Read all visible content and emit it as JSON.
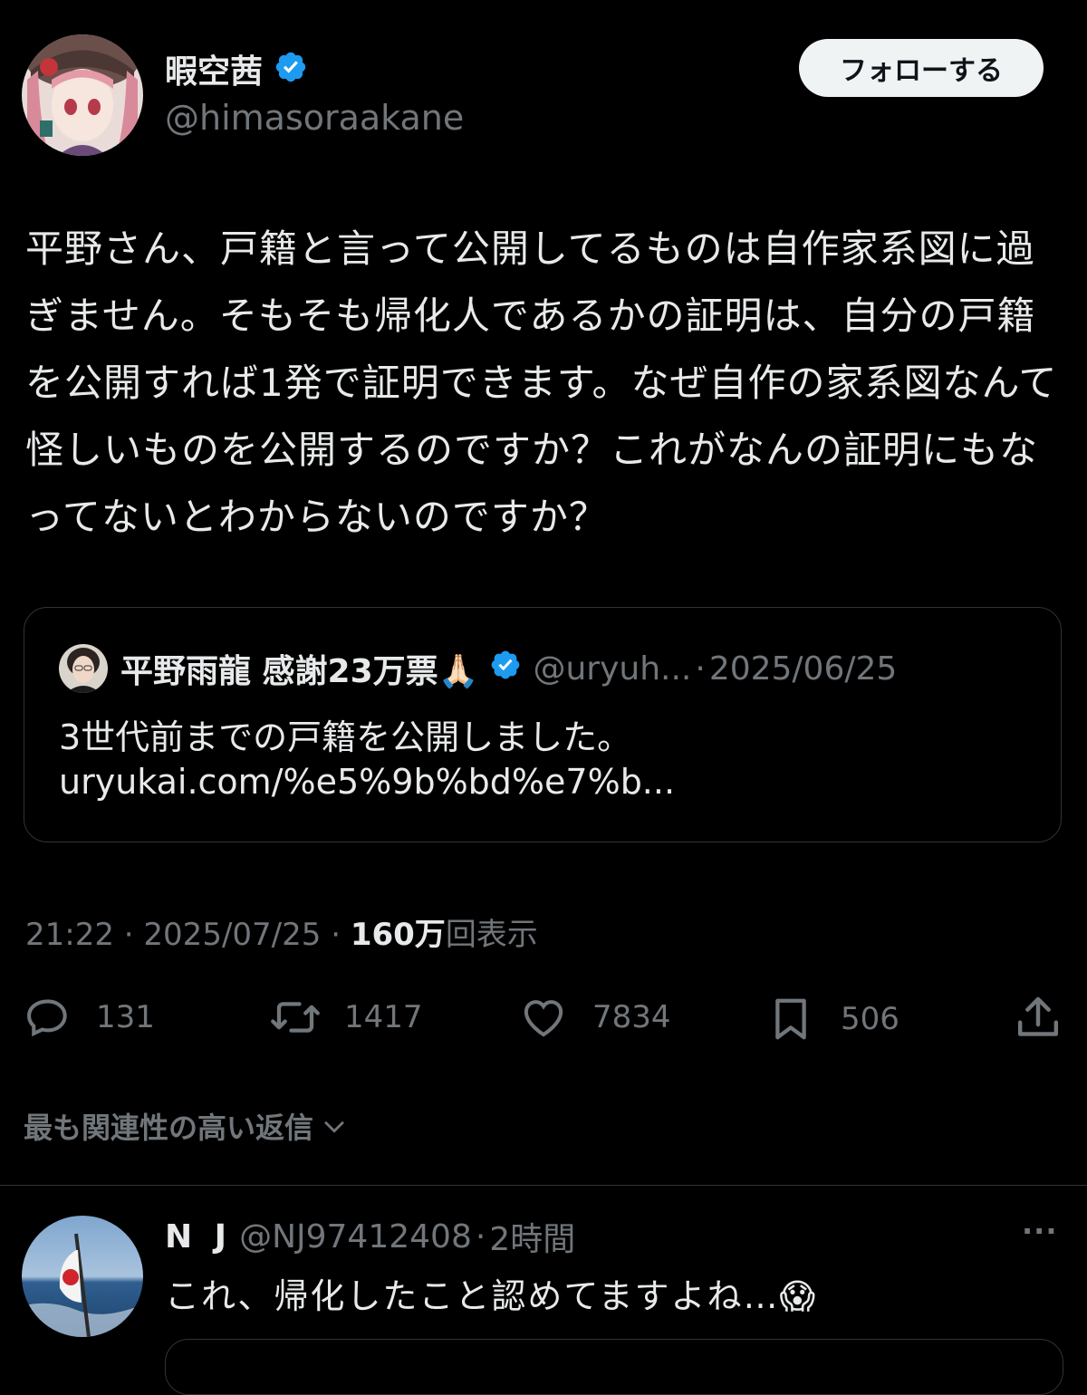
{
  "author": {
    "display_name": "暇空茜",
    "handle": "@himasoraakane",
    "verified": true
  },
  "follow_label": "フォローする",
  "tweet_text": "平野さん、戸籍と言って公開してるものは自作家系図に過ぎません。そもそも帰化人であるかの証明は、自分の戸籍を公開すれば1発で証明できます。なぜ自作の家系図なんて怪しいものを公開するのですか？これがなんの証明にもなってないとわからないのですか？",
  "quote": {
    "display_name": "平野雨龍 感謝23万票🙏🏻",
    "handle": "@uryuh...",
    "separator": "·",
    "date": "2025/06/25",
    "text": "3世代前までの戸籍を公開しました。",
    "link": "uryukai.com/%e5%9b%bd%e7%b..."
  },
  "meta": {
    "time": "21:22",
    "sep1": "·",
    "date": "2025/07/25",
    "sep2": "·",
    "views_count": "160万",
    "views_label": "回表示"
  },
  "actions": {
    "reply_count": "131",
    "retweet_count": "1417",
    "like_count": "7834",
    "bookmark_count": "506"
  },
  "replies_sort_label": "最も関連性の高い返信",
  "reply": {
    "display_name": "N J",
    "handle": "@NJ97412408",
    "separator": "·",
    "time": "2時間",
    "text": "これ、帰化したこと認めてますよね…😱",
    "more": "···"
  },
  "colors": {
    "background": "#000000",
    "text": "#e7e9ea",
    "muted": "#71767b",
    "verified": "#1d9bf0",
    "border": "#2f3336"
  }
}
